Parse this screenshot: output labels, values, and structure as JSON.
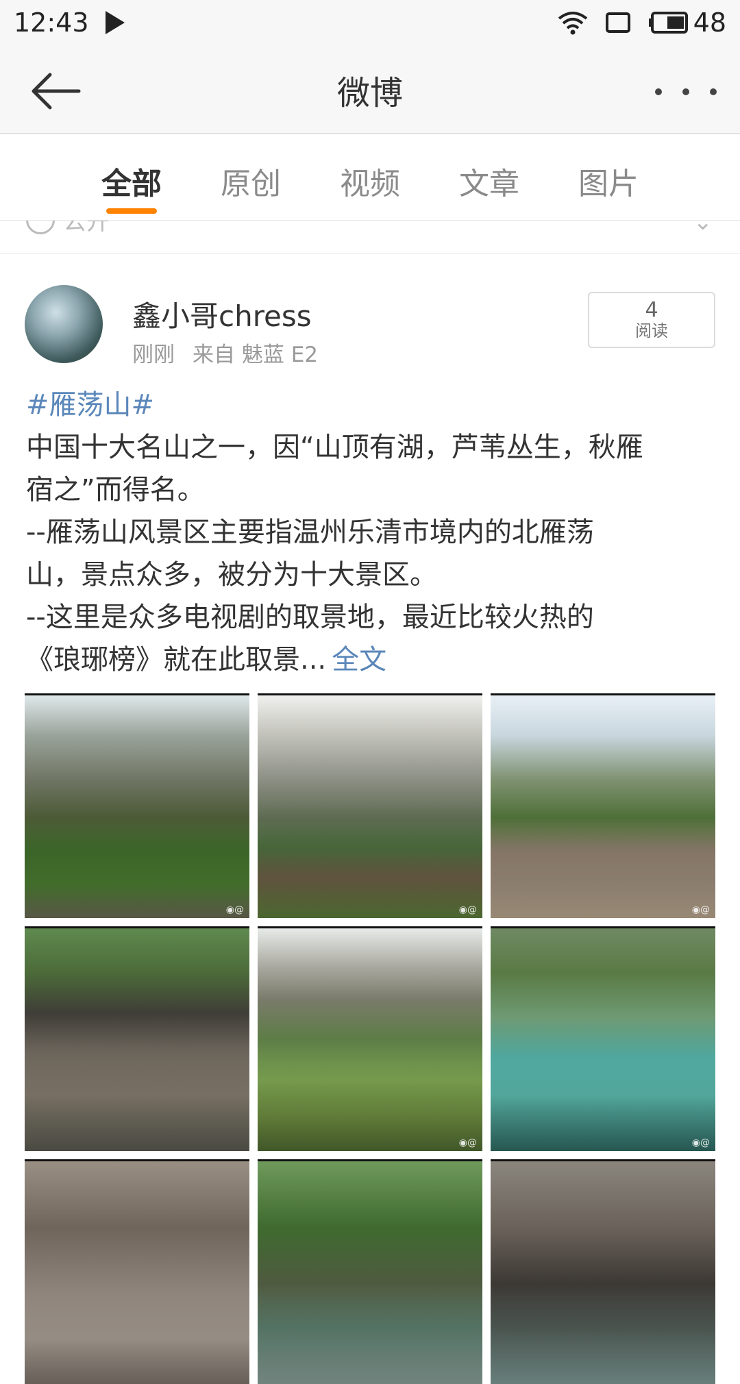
{
  "status_bar": {
    "time": "12:43",
    "battery": "48",
    "icons": [
      "play-icon",
      "wifi-icon",
      "screen-rotate-icon",
      "battery-icon"
    ]
  },
  "app_bar": {
    "title": "微博",
    "back_icon": "back-arrow-icon",
    "more_icon": "more-dots-icon"
  },
  "tabs": [
    {
      "label": "全部",
      "active": true
    },
    {
      "label": "原创",
      "active": false
    },
    {
      "label": "视频",
      "active": false
    },
    {
      "label": "文章",
      "active": false
    },
    {
      "label": "图片",
      "active": false
    }
  ],
  "prev_row": {
    "visibility_label": "公开"
  },
  "post": {
    "author": "鑫小哥chress",
    "time": "刚刚",
    "source": "来自 魅蓝 E2",
    "read_count": "4",
    "read_label": "阅读",
    "hashtag": "#雁荡山#",
    "lines": [
      "中国十大名山之一，因“山顶有湖，芦苇丛生，秋雁",
      "宿之”而得名。",
      "--雁荡山风景区主要指温州乐清市境内的北雁荡",
      "山，景点众多，被分为十大景区。",
      "--这里是众多电视剧的取景地，最近比较火热的"
    ],
    "last_line": "《琅琊榜》就在此取景...",
    "full_text_link": "全文",
    "photos": [
      {
        "name": "photo-cliff-village"
      },
      {
        "name": "photo-mountain-farmland"
      },
      {
        "name": "photo-stone-monument"
      },
      {
        "name": "photo-stone-house"
      },
      {
        "name": "photo-green-valley"
      },
      {
        "name": "photo-turquoise-pool"
      },
      {
        "name": "photo-waterfall"
      },
      {
        "name": "photo-forest-stream"
      },
      {
        "name": "photo-cave"
      }
    ]
  },
  "colors": {
    "accent_orange": "#ff8200",
    "link_blue": "#5b87ba"
  }
}
